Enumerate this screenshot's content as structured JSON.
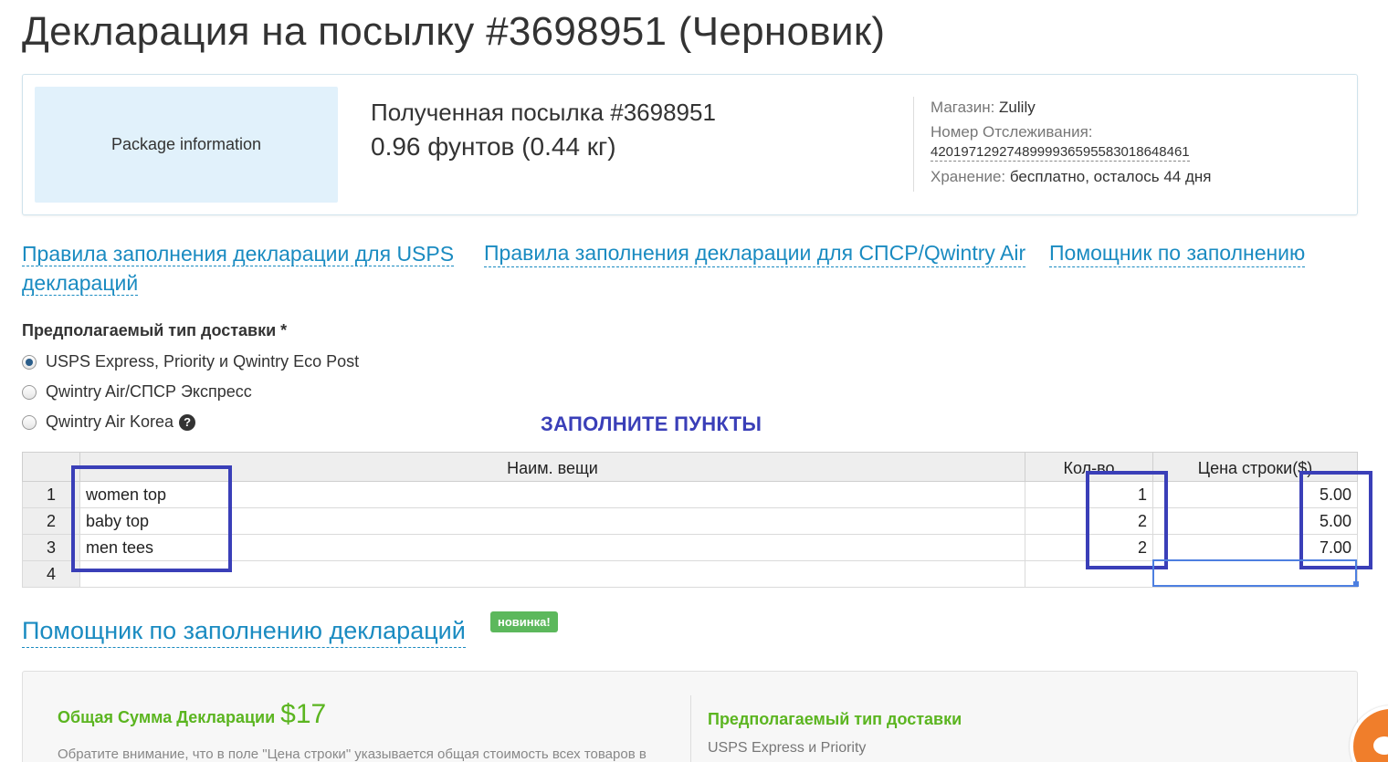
{
  "page": {
    "title": "Декларация на посылку #3698951 (Черновик)"
  },
  "package": {
    "image_placeholder": "Package information",
    "received": "Полученная посылка #3698951",
    "weight": "0.96 фунтов (0.44 кг)",
    "store_label": "Магазин:",
    "store_value": "Zulily",
    "tracking_label": "Номер Отслеживания:",
    "tracking_value": "420197129274899993659558301864846​1",
    "storage_label": "Хранение:",
    "storage_value": "бесплатно, осталось 44 дня"
  },
  "links": {
    "usps_rules_line1": "Правила заполнения декларации для USPS",
    "usps_rules_line2": "деклараций",
    "spsr_rules": "Правила заполнения декларации для СПСР/Qwintry Air",
    "helper": "Помощник по заполнению"
  },
  "shipping": {
    "label": "Предполагаемый тип доставки *",
    "options": [
      {
        "label": "USPS Express, Priority и Qwintry Eco Post",
        "checked": true
      },
      {
        "label": "Qwintry Air/СПСР Экспресс",
        "checked": false
      },
      {
        "label": "Qwintry Air Korea",
        "checked": false
      }
    ],
    "help_icon": "question-circle-icon"
  },
  "annotation": {
    "fill_items": "ЗАПОЛНИТЕ ПУНКТЫ",
    "color": "#3a3fb8"
  },
  "table": {
    "headers": {
      "num": "",
      "name": "Наим. вещи",
      "qty": "Кол-во",
      "price": "Цена строки($)"
    },
    "rows": [
      {
        "num": "1",
        "name": "women top",
        "qty": "1",
        "price": "5.00"
      },
      {
        "num": "2",
        "name": "baby top",
        "qty": "2",
        "price": "5.00"
      },
      {
        "num": "3",
        "name": "men tees",
        "qty": "2",
        "price": "7.00"
      },
      {
        "num": "4",
        "name": "",
        "qty": "",
        "price": ""
      }
    ]
  },
  "helper_section": {
    "title": "Помощник по заполнению деклараций",
    "badge": "новинка!"
  },
  "summary": {
    "total_label": "Общая Сумма Декларации",
    "total_value": "$17",
    "note": "Обратите внимание, что в поле \"Цена строки\" указывается общая стоимость всех товаров в",
    "shipping_title": "Предполагаемый тип доставки",
    "shipping_value": "USPS Express и Priority"
  },
  "colors": {
    "link": "#1a8bc1",
    "green": "#5bb520",
    "badge": "#5cb85c",
    "chat": "#f07e2b"
  }
}
